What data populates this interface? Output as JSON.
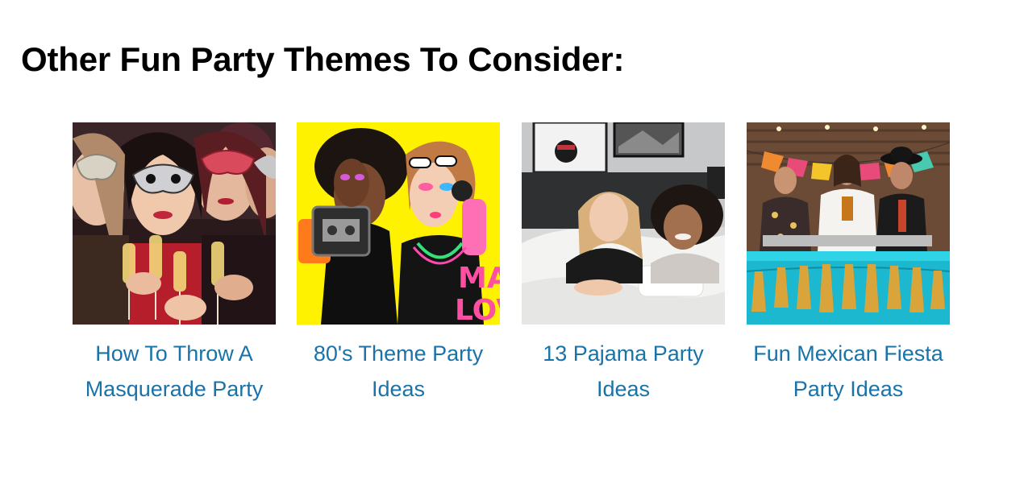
{
  "section": {
    "title": "Other Fun Party Themes To Consider:"
  },
  "cards": [
    {
      "title_lines": [
        "How To Throw A",
        "Masquerade Party"
      ],
      "image_icon": "masquerade-photo"
    },
    {
      "title_lines": [
        "80's Theme Party",
        "Ideas"
      ],
      "image_icon": "eighties-photo",
      "image_text": [
        "MA",
        "LOV"
      ]
    },
    {
      "title_lines": [
        "13 Pajama Party",
        "Ideas"
      ],
      "image_icon": "pajama-photo"
    },
    {
      "title_lines": [
        "Fun Mexican Fiesta",
        "Party Ideas"
      ],
      "image_icon": "fiesta-photo"
    }
  ],
  "colors": {
    "link": "#1a73a8",
    "heading": "#000000"
  }
}
